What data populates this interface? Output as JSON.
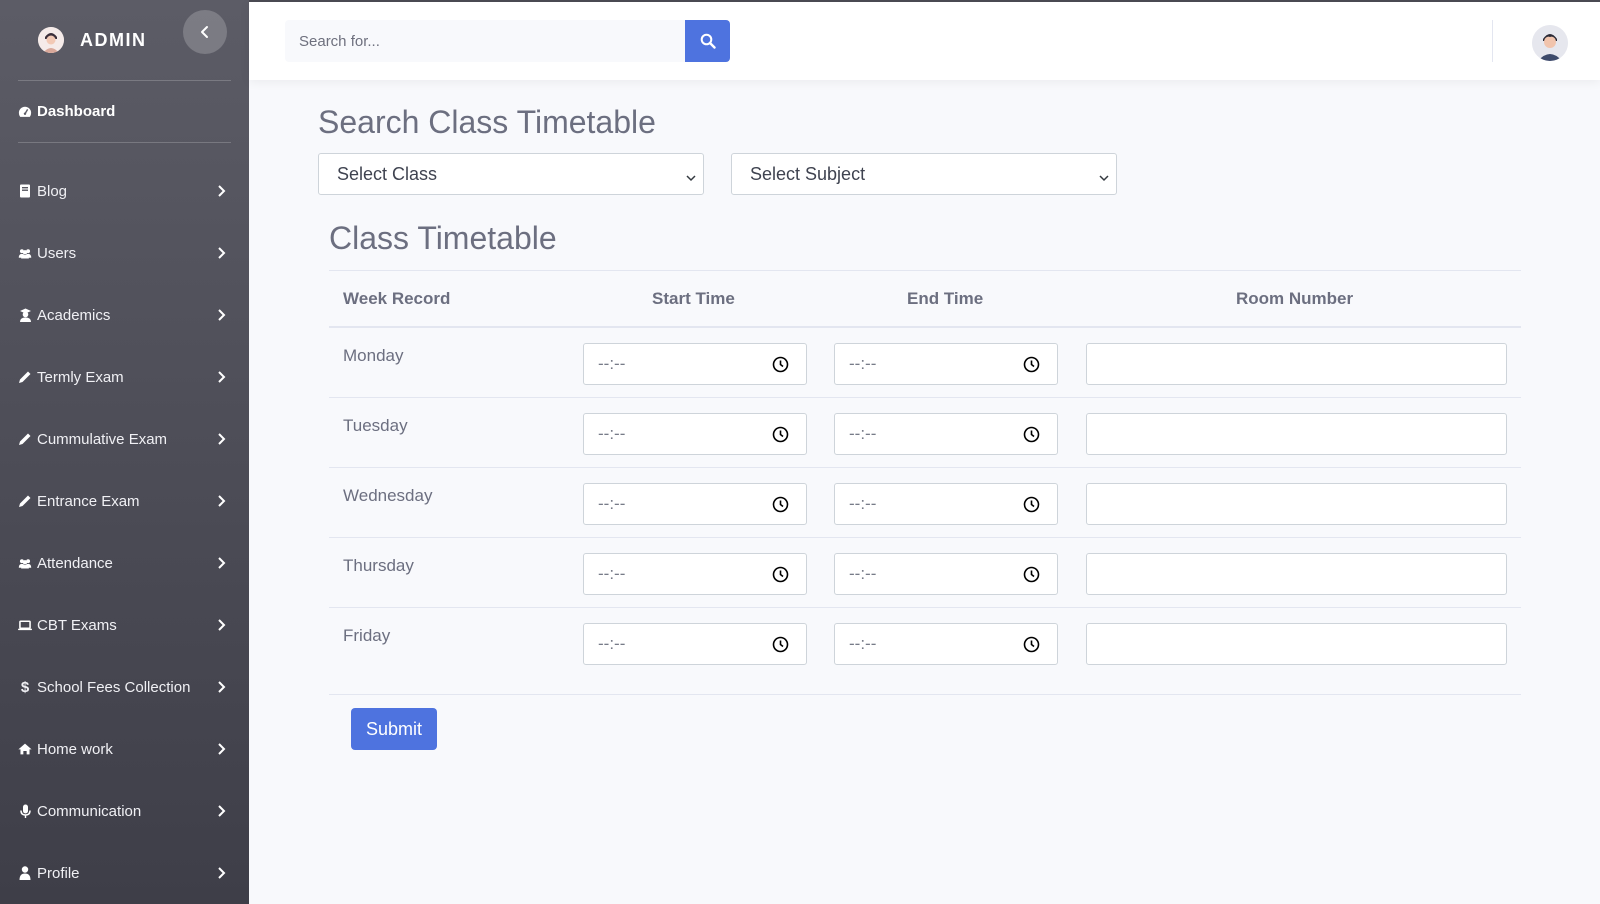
{
  "sidebar": {
    "brand": "ADMIN",
    "dashboard_label": "Dashboard",
    "items": [
      {
        "label": "Blog",
        "icon": "book-icon"
      },
      {
        "label": "Users",
        "icon": "users-icon"
      },
      {
        "label": "Academics",
        "icon": "graduate-icon"
      },
      {
        "label": "Termly Exam",
        "icon": "pencil-icon"
      },
      {
        "label": "Cummulative Exam",
        "icon": "pencil-icon"
      },
      {
        "label": "Entrance Exam",
        "icon": "pencil-icon"
      },
      {
        "label": "Attendance",
        "icon": "users-icon"
      },
      {
        "label": "CBT Exams",
        "icon": "laptop-icon"
      },
      {
        "label": "School Fees Collection",
        "icon": "dollar-icon"
      },
      {
        "label": "Home work",
        "icon": "home-icon"
      },
      {
        "label": "Communication",
        "icon": "microphone-icon"
      },
      {
        "label": "Profile",
        "icon": "user-icon"
      }
    ]
  },
  "topbar": {
    "search_placeholder": "Search for..."
  },
  "main": {
    "title": "Search Class Timetable",
    "select_class": "Select Class",
    "select_subject": "Select Subject",
    "section_title": "Class Timetable",
    "columns": [
      "Week Record",
      "Start Time",
      "End Time",
      "Room Number"
    ],
    "rows": [
      {
        "day": "Monday",
        "start": "--:--",
        "end": "--:--",
        "room": ""
      },
      {
        "day": "Tuesday",
        "start": "--:--",
        "end": "--:--",
        "room": ""
      },
      {
        "day": "Wednesday",
        "start": "--:--",
        "end": "--:--",
        "room": ""
      },
      {
        "day": "Thursday",
        "start": "--:--",
        "end": "--:--",
        "room": ""
      },
      {
        "day": "Friday",
        "start": "--:--",
        "end": "--:--",
        "room": ""
      }
    ],
    "submit_label": "Submit"
  },
  "colors": {
    "accent": "#4e73df",
    "sidebar_top": "#5c5c66",
    "sidebar_bottom": "#3e3e48"
  }
}
